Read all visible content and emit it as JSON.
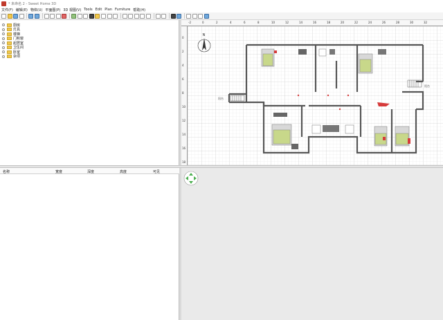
{
  "window": {
    "title": "*  未命名 2 - Sweet Home 3D"
  },
  "menu": [
    "文件(F)",
    "编辑(E)",
    "物体(U)",
    "平面图(P)",
    "3D 视图(V)",
    "Tools",
    "Edit",
    "Plan",
    "Furniture",
    "帮助(H)"
  ],
  "catalog": {
    "categories": [
      "厨房",
      "灯具",
      "楼梯",
      "门和窗",
      "起居室",
      "卫生间",
      "卧室",
      "杂项"
    ]
  },
  "furniture_table": {
    "columns": [
      "名称",
      "宽度",
      "深度",
      "高度",
      "可见"
    ]
  },
  "plan": {
    "ruler_top": [
      "-2",
      "0",
      "2",
      "4",
      "6",
      "8",
      "10",
      "12",
      "14",
      "16",
      "18",
      "20",
      "22",
      "24",
      "26",
      "28",
      "30",
      "32"
    ],
    "ruler_left": [
      "0",
      "2",
      "4",
      "6",
      "8",
      "10",
      "12",
      "14",
      "16",
      "18"
    ],
    "compass_label": "N",
    "stair_labels": [
      "阳台",
      "阳台"
    ]
  },
  "colors": {
    "highlight_red": "#d63b3b",
    "bed_green": "#c8d88a",
    "grid": "#d8d8d8"
  }
}
